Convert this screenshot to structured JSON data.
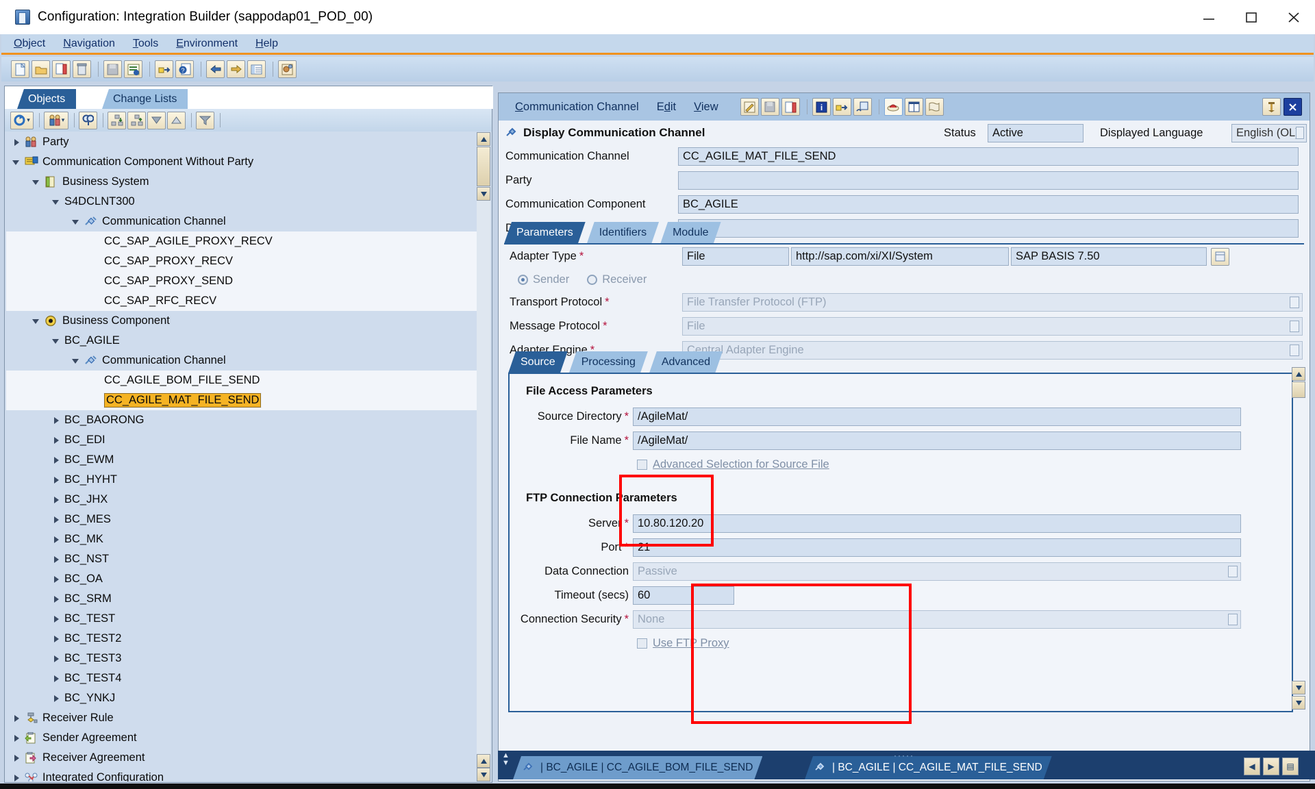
{
  "window": {
    "title": "Configuration: Integration Builder (sappodap01_POD_00)",
    "app_icon": "integration-builder-icon",
    "minimize": "–",
    "maximize": "□",
    "close": "✕"
  },
  "menubar": {
    "items": [
      {
        "label": "Object",
        "accel": "O"
      },
      {
        "label": "Navigation",
        "accel": "N"
      },
      {
        "label": "Tools",
        "accel": "T"
      },
      {
        "label": "Environment",
        "accel": "E"
      },
      {
        "label": "Help",
        "accel": "H"
      }
    ]
  },
  "main_toolbar": {
    "buttons": [
      "new-document-icon",
      "open-folder-icon",
      "copy-document-icon",
      "delete-trash-icon",
      "save-disabled-icon",
      "check-list-icon",
      "transport-arrow-icon",
      "where-used-icon",
      "back-arrow-icon",
      "forward-arrow-icon",
      "list-view-icon",
      "user-settings-icon"
    ]
  },
  "left_panel": {
    "tabs": [
      {
        "label": "Objects",
        "active": true
      },
      {
        "label": "Change Lists",
        "active": false
      }
    ],
    "toolbar_buttons": [
      "refresh-icon",
      "refresh-dropdown-icon",
      "party-filter-icon",
      "party-dropdown-icon",
      "find-icon",
      "expand-node-icon",
      "collapse-node-icon",
      "scroll-down-icon",
      "scroll-up-icon",
      "filter-icon"
    ],
    "tree": [
      {
        "label": "Party",
        "indent": 0,
        "twist": "closed",
        "icon": "party-icon",
        "shaded": true
      },
      {
        "label": "Communication Component Without Party",
        "indent": 0,
        "twist": "open",
        "icon": "comm-component-icon",
        "shaded": true
      },
      {
        "label": "Business System",
        "indent": 1,
        "twist": "open",
        "icon": "business-system-icon",
        "shaded": true
      },
      {
        "label": "S4DCLNT300",
        "indent": 2,
        "twist": "open",
        "icon": "none",
        "shaded": true
      },
      {
        "label": "Communication Channel",
        "indent": 3,
        "twist": "open",
        "icon": "channel-icon",
        "shaded": true
      },
      {
        "label": "CC_SAP_AGILE_PROXY_RECV",
        "indent": 4,
        "twist": "none",
        "icon": "none",
        "shaded": false
      },
      {
        "label": "CC_SAP_PROXY_RECV",
        "indent": 4,
        "twist": "none",
        "icon": "none",
        "shaded": false
      },
      {
        "label": "CC_SAP_PROXY_SEND",
        "indent": 4,
        "twist": "none",
        "icon": "none",
        "shaded": false
      },
      {
        "label": "CC_SAP_RFC_RECV",
        "indent": 4,
        "twist": "none",
        "icon": "none",
        "shaded": false
      },
      {
        "label": "Business Component",
        "indent": 1,
        "twist": "open",
        "icon": "business-component-icon",
        "shaded": true
      },
      {
        "label": "BC_AGILE",
        "indent": 2,
        "twist": "open",
        "icon": "none",
        "shaded": true
      },
      {
        "label": "Communication Channel",
        "indent": 3,
        "twist": "open",
        "icon": "channel-icon",
        "shaded": true
      },
      {
        "label": "CC_AGILE_BOM_FILE_SEND",
        "indent": 4,
        "twist": "none",
        "icon": "none",
        "shaded": false
      },
      {
        "label": "CC_AGILE_MAT_FILE_SEND",
        "indent": 4,
        "twist": "none",
        "icon": "none",
        "shaded": false,
        "selected": true
      },
      {
        "label": "BC_BAORONG",
        "indent": 2,
        "twist": "closed",
        "icon": "none",
        "shaded": true
      },
      {
        "label": "BC_EDI",
        "indent": 2,
        "twist": "closed",
        "icon": "none",
        "shaded": true
      },
      {
        "label": "BC_EWM",
        "indent": 2,
        "twist": "closed",
        "icon": "none",
        "shaded": true
      },
      {
        "label": "BC_HYHT",
        "indent": 2,
        "twist": "closed",
        "icon": "none",
        "shaded": true
      },
      {
        "label": "BC_JHX",
        "indent": 2,
        "twist": "closed",
        "icon": "none",
        "shaded": true
      },
      {
        "label": "BC_MES",
        "indent": 2,
        "twist": "closed",
        "icon": "none",
        "shaded": true
      },
      {
        "label": "BC_MK",
        "indent": 2,
        "twist": "closed",
        "icon": "none",
        "shaded": true
      },
      {
        "label": "BC_NST",
        "indent": 2,
        "twist": "closed",
        "icon": "none",
        "shaded": true
      },
      {
        "label": "BC_OA",
        "indent": 2,
        "twist": "closed",
        "icon": "none",
        "shaded": true
      },
      {
        "label": "BC_SRM",
        "indent": 2,
        "twist": "closed",
        "icon": "none",
        "shaded": true
      },
      {
        "label": "BC_TEST",
        "indent": 2,
        "twist": "closed",
        "icon": "none",
        "shaded": true
      },
      {
        "label": "BC_TEST2",
        "indent": 2,
        "twist": "closed",
        "icon": "none",
        "shaded": true
      },
      {
        "label": "BC_TEST3",
        "indent": 2,
        "twist": "closed",
        "icon": "none",
        "shaded": true
      },
      {
        "label": "BC_TEST4",
        "indent": 2,
        "twist": "closed",
        "icon": "none",
        "shaded": true
      },
      {
        "label": "BC_YNKJ",
        "indent": 2,
        "twist": "closed",
        "icon": "none",
        "shaded": true
      },
      {
        "label": "Receiver Rule",
        "indent": 0,
        "twist": "closed",
        "icon": "receiver-rule-icon",
        "shaded": true
      },
      {
        "label": "Sender Agreement",
        "indent": 0,
        "twist": "closed",
        "icon": "sender-agreement-icon",
        "shaded": true
      },
      {
        "label": "Receiver Agreement",
        "indent": 0,
        "twist": "closed",
        "icon": "receiver-agreement-icon",
        "shaded": true
      },
      {
        "label": "Integrated Configuration",
        "indent": 0,
        "twist": "closed",
        "icon": "integrated-config-icon",
        "shaded": true
      }
    ]
  },
  "right_panel": {
    "toolbar": {
      "menus": [
        {
          "label": "Communication Channel",
          "accel": "C"
        },
        {
          "label": "Edit",
          "accel": "d"
        },
        {
          "label": "View",
          "accel": "V"
        }
      ],
      "buttons": [
        "edit-pencil-icon",
        "save-disabled-icon",
        "copy-icon",
        "info-icon",
        "transport-icon",
        "where-used-icon",
        "cache-icon",
        "documentation-icon",
        "print-icon"
      ],
      "pin_icon": "pin-icon",
      "close_icon": "close-panel-icon"
    },
    "header": {
      "icon": "channel-icon",
      "title": "Display Communication Channel",
      "status_label": "Status",
      "status_value": "Active",
      "language_label": "Displayed Language",
      "language_value": "English (OL)"
    },
    "fields": [
      {
        "label": "Communication Channel",
        "value": "CC_AGILE_MAT_FILE_SEND"
      },
      {
        "label": "Party",
        "value": ""
      },
      {
        "label": "Communication Component",
        "value": "BC_AGILE"
      },
      {
        "label": "Description",
        "value": ""
      }
    ],
    "tabs": [
      {
        "label": "Parameters",
        "active": true
      },
      {
        "label": "Identifiers",
        "active": false
      },
      {
        "label": "Module",
        "active": false
      }
    ],
    "parameters": {
      "adapter_type_label": "Adapter Type",
      "adapter_type_value": "File",
      "adapter_namespace": "http://sap.com/xi/XI/System",
      "adapter_swcv": "SAP BASIS 7.50",
      "direction": {
        "sender_label": "Sender",
        "receiver_label": "Receiver",
        "selected": "Sender"
      },
      "rows": [
        {
          "label": "Transport Protocol",
          "value": "File Transfer Protocol (FTP)",
          "required": true,
          "dropdown": true
        },
        {
          "label": "Message Protocol",
          "value": "File",
          "required": true,
          "dropdown": true
        },
        {
          "label": "Adapter Engine",
          "value": "Central Adapter Engine",
          "required": true,
          "dropdown": true
        }
      ]
    },
    "inner_tabs": [
      {
        "label": "Source",
        "active": true
      },
      {
        "label": "Processing",
        "active": false
      },
      {
        "label": "Advanced",
        "active": false
      }
    ],
    "file_access": {
      "section_title": "File Access Parameters",
      "rows": [
        {
          "label": "Source Directory",
          "value": "/AgileMat/",
          "required": true
        },
        {
          "label": "File Name",
          "value": "/AgileMat/",
          "required": true
        }
      ],
      "checkbox_label": "Advanced Selection for Source File",
      "checkbox_checked": false
    },
    "ftp_connection": {
      "section_title": "FTP Connection Parameters",
      "rows": [
        {
          "label": "Server",
          "value": "10.80.120.20",
          "required": true,
          "disabled": false
        },
        {
          "label": "Port",
          "value": "21",
          "required": true,
          "disabled": false
        },
        {
          "label": "Data Connection",
          "value": "Passive",
          "required": false,
          "disabled": true,
          "dropdown": true
        },
        {
          "label": "Timeout (secs)",
          "value": "60",
          "required": false,
          "disabled": false
        },
        {
          "label": "Connection Security",
          "value": "None",
          "required": true,
          "disabled": true,
          "dropdown": true
        }
      ],
      "checkbox_label": "Use FTP Proxy",
      "checkbox_checked": false
    },
    "annotations": {
      "box_color": "#ff0000",
      "box1_target": "source-directory-and-file-name",
      "box2_target": "ftp-server-port-timeout-security"
    }
  },
  "bottom_tabs": [
    {
      "label": "| BC_AGILE | CC_AGILE_BOM_FILE_SEND",
      "icon": "channel-icon",
      "active": false
    },
    {
      "label": "| BC_AGILE | CC_AGILE_MAT_FILE_SEND",
      "icon": "channel-icon",
      "active": true
    }
  ],
  "bottom_nav": {
    "prev": "◀",
    "next": "▶",
    "list": "▤"
  }
}
